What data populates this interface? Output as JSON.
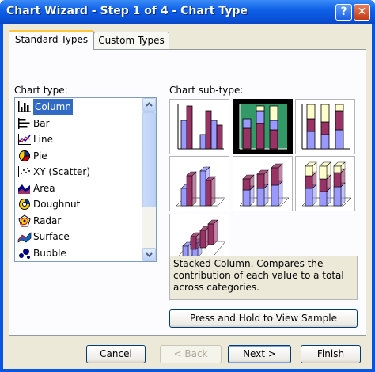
{
  "window": {
    "title": "Chart Wizard - Step 1 of 4 - Chart Type",
    "help_glyph": "?",
    "close_glyph": "✕"
  },
  "tabs": [
    {
      "label": "Standard Types",
      "selected": true
    },
    {
      "label": "Custom Types",
      "selected": false
    }
  ],
  "chart_type": {
    "label": "Chart type:",
    "items": [
      {
        "label": "Column",
        "icon": "column-chart-icon",
        "selected": true
      },
      {
        "label": "Bar",
        "icon": "bar-chart-icon"
      },
      {
        "label": "Line",
        "icon": "line-chart-icon"
      },
      {
        "label": "Pie",
        "icon": "pie-chart-icon"
      },
      {
        "label": "XY (Scatter)",
        "icon": "scatter-chart-icon"
      },
      {
        "label": "Area",
        "icon": "area-chart-icon"
      },
      {
        "label": "Doughnut",
        "icon": "doughnut-chart-icon"
      },
      {
        "label": "Radar",
        "icon": "radar-chart-icon"
      },
      {
        "label": "Surface",
        "icon": "surface-chart-icon"
      },
      {
        "label": "Bubble",
        "icon": "bubble-chart-icon"
      }
    ]
  },
  "subtype": {
    "label": "Chart sub-type:",
    "selected_index": 1,
    "options": [
      {
        "name": "clustered-column"
      },
      {
        "name": "stacked-column"
      },
      {
        "name": "100-percent-stacked-column"
      },
      {
        "name": "3d-clustered-column"
      },
      {
        "name": "3d-stacked-column"
      },
      {
        "name": "3d-100-percent-stacked-column"
      },
      {
        "name": "3d-column"
      }
    ],
    "description": "Stacked Column. Compares the contribution of each value to a total across categories."
  },
  "sample_button": {
    "label": "Press and Hold to View Sample"
  },
  "footer": {
    "cancel": "Cancel",
    "back": "< Back",
    "next": "Next >",
    "finish": "Finish"
  },
  "colors": {
    "series1": "#993366",
    "series2": "#9999FF",
    "series3": "#FFFFCC",
    "series_dark_bg": "#339966",
    "selection": "#316AC5"
  }
}
